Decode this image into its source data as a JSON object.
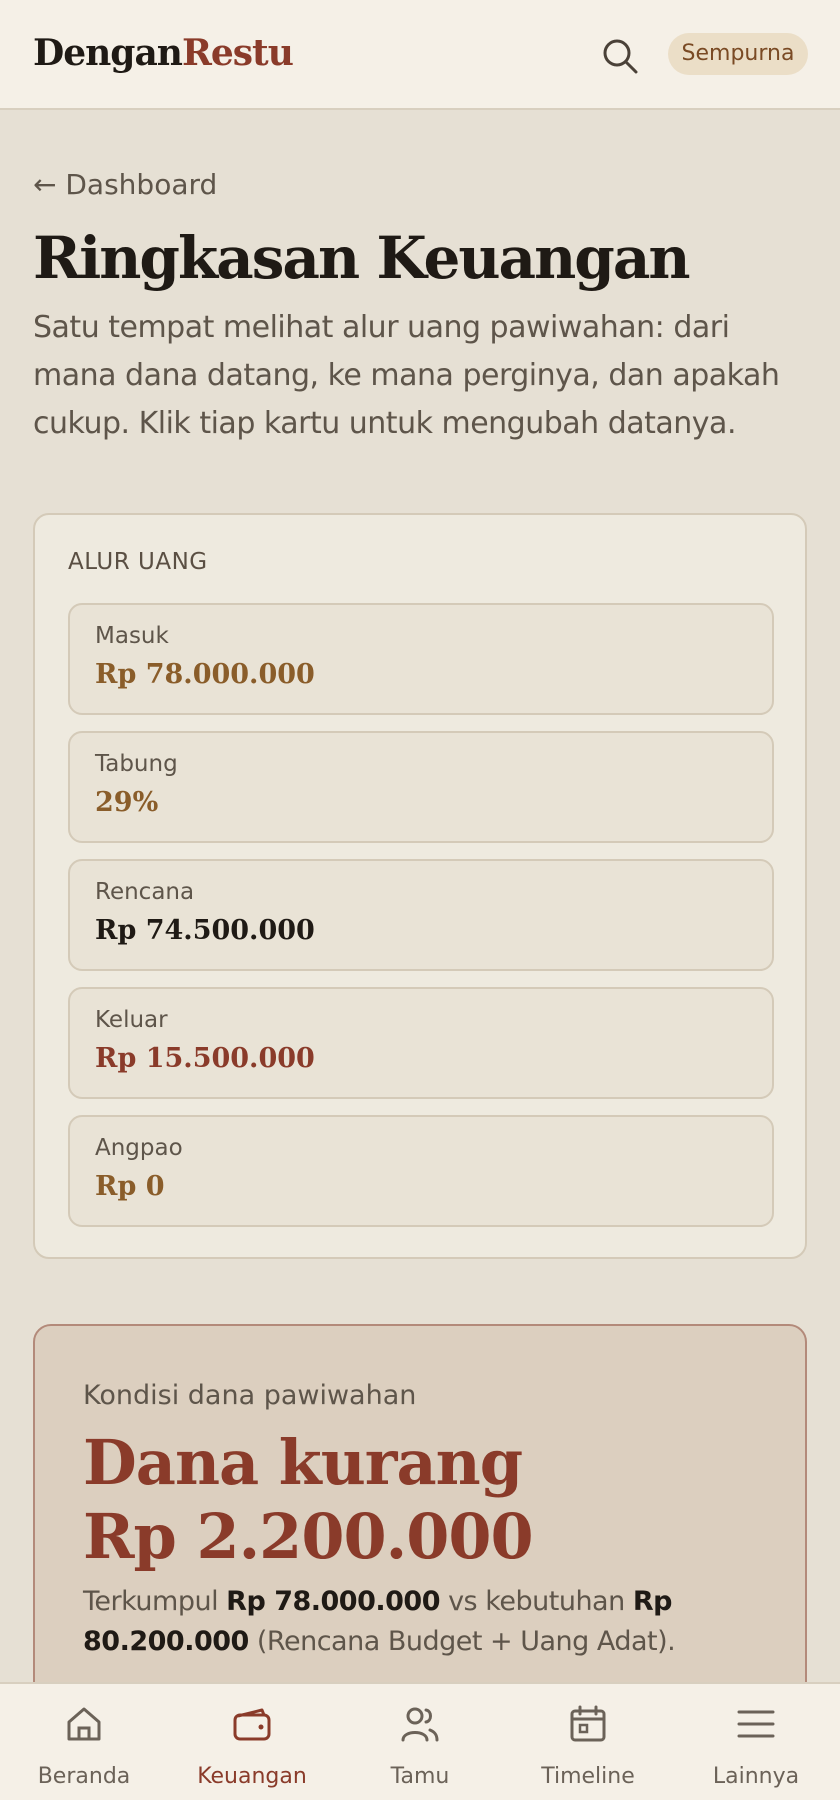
{
  "header": {
    "logo_part1": "Dengan",
    "logo_part2": "Restu",
    "status": "Sempurna"
  },
  "back_link": "← Dashboard",
  "page": {
    "title": "Ringkasan Keuangan",
    "description": "Satu tempat melihat alur uang pawiwahan: dari mana dana datang, ke mana perginya, dan apakah cukup. Klik tiap kartu untuk mengubah datanya."
  },
  "flow": {
    "title": "ALUR UANG",
    "items": [
      {
        "label": "Masuk",
        "value": "Rp 78.000.000",
        "color": "#8a5d2a"
      },
      {
        "label": "Tabung",
        "value": "29%",
        "color": "#8a5d2a"
      },
      {
        "label": "Rencana",
        "value": "Rp 74.500.000",
        "color": "#1f1a15"
      },
      {
        "label": "Keluar",
        "value": "Rp 15.500.000",
        "color": "#8a3b2a"
      },
      {
        "label": "Angpao",
        "value": "Rp 0",
        "color": "#8a5d2a"
      }
    ]
  },
  "condition": {
    "subtitle": "Kondisi dana pawiwahan",
    "headline_line1": "Dana kurang",
    "headline_line2": "Rp 2.200.000",
    "detail_prefix": "Terkumpul ",
    "collected": "Rp 78.000.000",
    "detail_mid": " vs kebutuhan ",
    "needed": "Rp 80.200.000",
    "detail_suffix": " (Rencana Budget + Uang Adat)."
  },
  "nav": [
    {
      "label": "Beranda",
      "icon": "home-icon"
    },
    {
      "label": "Keuangan",
      "icon": "wallet-icon",
      "active": true
    },
    {
      "label": "Tamu",
      "icon": "users-icon"
    },
    {
      "label": "Timeline",
      "icon": "calendar-icon"
    },
    {
      "label": "Lainnya",
      "icon": "menu-icon"
    }
  ],
  "colors": {
    "accent": "#8a3b2a",
    "gold": "#8a5d2a",
    "background": "#e6e0d4"
  }
}
